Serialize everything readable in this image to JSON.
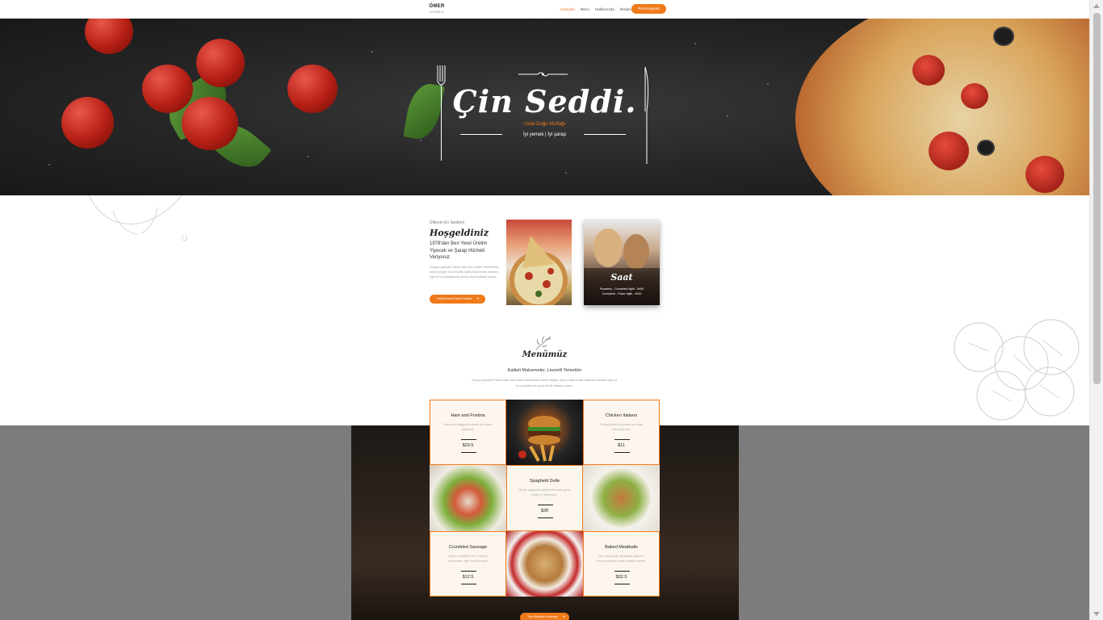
{
  "header": {
    "logo_line1": "ÖMER",
    "logo_line2": "DURMUŞ",
    "nav": [
      "Anasayfa",
      "Menu",
      "Hakkımızda",
      "İletişim"
    ],
    "reservation_label": "Rezervasyon"
  },
  "hero": {
    "title": "Çin Seddi.",
    "subtitle": "Uzak Doğu Mutfağı",
    "tagline": "İyi yemek | İyi şarap"
  },
  "welcome": {
    "small": "Ülkenin En Sevileni",
    "title": "Hoşgeldiniz",
    "subtitle": "1978'den Beri Yerel Üretim Yiyecek ve Şarap Hizmeti Veriyoruz",
    "body": "Gorgon gravida Planet nibh sed ornare elementum amet integer nisi ut dictis audio Maecenas nornero eget id ut cupidatat nis auctu elorit tutiasis ornare.",
    "button_label": "Hakkımızda Daha Fazlası",
    "button_arrow": "➔"
  },
  "hours": {
    "title": "Saat",
    "line1": "Pazartesi - Cumartesi 9glib - 0e06",
    "line2": "Cumartesi - Pazar 9glib - 4h00"
  },
  "menu": {
    "title": "Menümüz",
    "subtitle": "Kaliteli Malzemeler, Lezzetli Yemekler",
    "body": "Gorgon gravida Planet nibh sed ornare elementum amet integer nisi ut dictis audio Maecen nornero eget id ut cupidatat nis auctu elorit tutiasis ornare.",
    "items": [
      {
        "name": "Ham and Fontina",
        "desc": "Bresaola biaggiotti pancet ma salad baraboni.",
        "price": "$29.5"
      },
      {
        "name": "Chicken Italiano",
        "desc": "Fruitpeperferent pasta nuc rega ekmentur ad.",
        "price": "$11"
      },
      {
        "name": "Spaghetti Delle",
        "desc": "Rustic spagetti loaded with herb garlic butter & parmesan.",
        "price": "$28"
      },
      {
        "name": "Crumbled Sausage",
        "desc": "Italian crumbled herb, fontina, mozzarella, with fresh tomato.",
        "price": "$12.5"
      },
      {
        "name": "Baked Meatballs",
        "desc": "Our handmade meatballs baked in savory marinara with melted cheese.",
        "price": "$32.5"
      }
    ],
    "more_button": "Tüm Menüyü İnceleyin",
    "more_arrow": "➔"
  }
}
